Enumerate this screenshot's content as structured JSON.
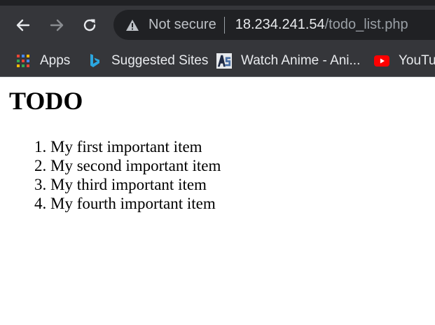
{
  "browser": {
    "security_label": "Not secure",
    "url_host": "18.234.241.54",
    "url_path": "/todo_list.php",
    "bookmarks": [
      {
        "label": "Apps",
        "icon": "apps-grid-icon"
      },
      {
        "label": "Suggested Sites",
        "icon": "bing-icon"
      },
      {
        "label": "Watch Anime - Ani...",
        "icon": "anime-site-icon"
      },
      {
        "label": "YouTub",
        "icon": "youtube-icon"
      }
    ],
    "colors": {
      "toolbar": "#35363a",
      "omnibox": "#202124",
      "youtube_red": "#ff0000"
    }
  },
  "page": {
    "title": "TODO",
    "items": [
      "My first important item",
      "My second important item",
      "My third important item",
      "My fourth important item"
    ]
  }
}
